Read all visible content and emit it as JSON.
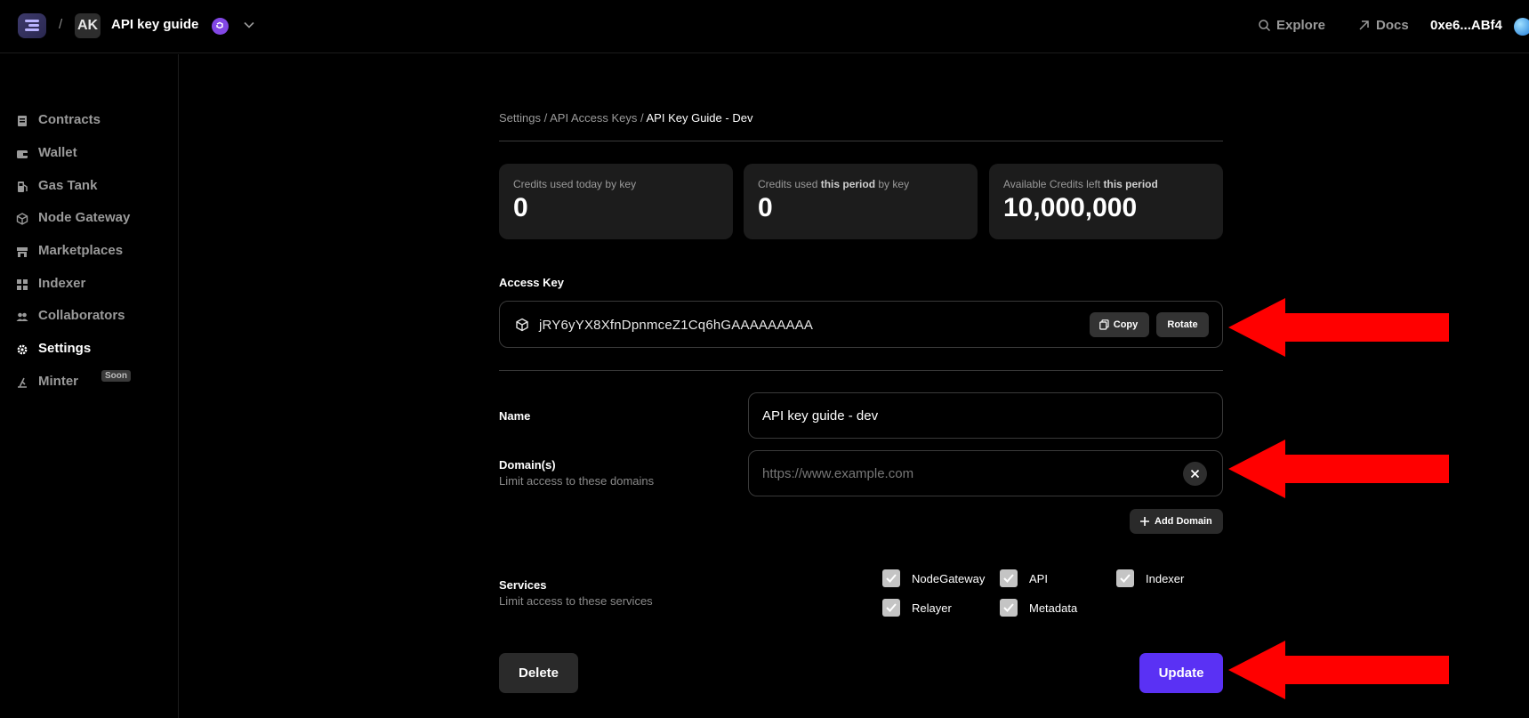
{
  "header": {
    "separator": "/",
    "project_initials": "AK",
    "project_name": "API key guide",
    "explore_label": "Explore",
    "docs_label": "Docs",
    "wallet_address": "0xe6...ABf4"
  },
  "sidebar": {
    "items": [
      {
        "label": "Contracts",
        "icon": "contract-icon"
      },
      {
        "label": "Wallet",
        "icon": "wallet-icon"
      },
      {
        "label": "Gas Tank",
        "icon": "gas-pump-icon"
      },
      {
        "label": "Node Gateway",
        "icon": "cube-icon"
      },
      {
        "label": "Marketplaces",
        "icon": "storefront-icon"
      },
      {
        "label": "Indexer",
        "icon": "grid-icon"
      },
      {
        "label": "Collaborators",
        "icon": "people-icon"
      },
      {
        "label": "Settings",
        "icon": "gear-icon",
        "active": true
      },
      {
        "label": "Minter",
        "icon": "minter-icon",
        "badge": "Soon"
      }
    ]
  },
  "breadcrumb": {
    "part1": "Settings",
    "part2": "API Access Keys",
    "current": "API Key Guide - Dev",
    "sep": " / "
  },
  "stats": [
    {
      "label_pre": "Credits used today by key",
      "label_bold": "",
      "label_post": "",
      "value": "0"
    },
    {
      "label_pre": "Credits used ",
      "label_bold": "this period",
      "label_post": " by key",
      "value": "0"
    },
    {
      "label_pre": "Available Credits left ",
      "label_bold": "this period",
      "label_post": "",
      "value": "10,000,000"
    }
  ],
  "access_key": {
    "label": "Access Key",
    "value": "jRY6yYX8XfnDpnmceZ1Cq6hGAAAAAAAAA",
    "copy_label": "Copy",
    "rotate_label": "Rotate"
  },
  "form": {
    "name_label": "Name",
    "name_value": "API key guide - dev",
    "domains_label": "Domain(s)",
    "domains_sub": "Limit access to these domains",
    "domain_placeholder": "https://www.example.com",
    "add_domain_label": "Add Domain",
    "services_label": "Services",
    "services_sub": "Limit access to these services",
    "services": [
      {
        "label": "NodeGateway",
        "checked": true
      },
      {
        "label": "API",
        "checked": true
      },
      {
        "label": "Indexer",
        "checked": true
      },
      {
        "label": "Relayer",
        "checked": true
      },
      {
        "label": "Metadata",
        "checked": true
      }
    ]
  },
  "actions": {
    "delete_label": "Delete",
    "update_label": "Update"
  },
  "colors": {
    "accent": "#5a31f4",
    "annotation_arrow": "#ff0000",
    "chain": "#8247e5"
  }
}
